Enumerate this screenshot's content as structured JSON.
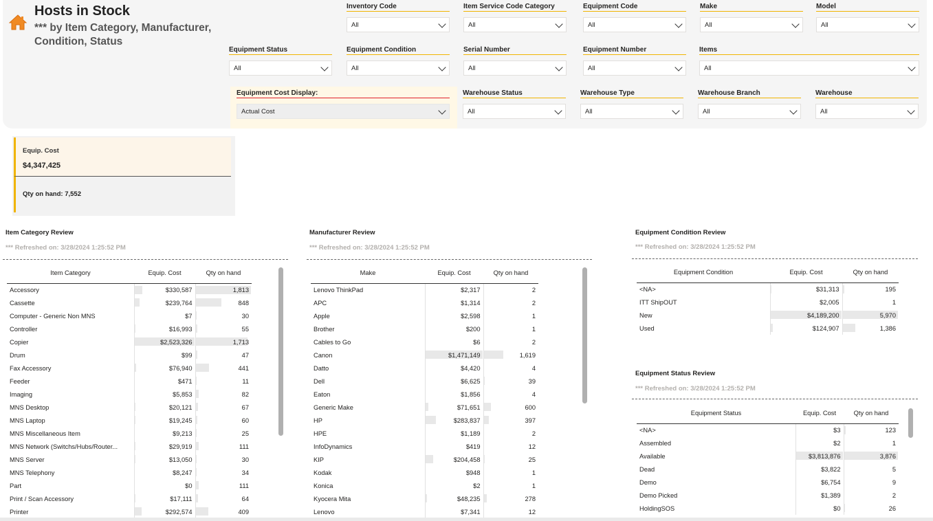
{
  "header": {
    "title": "Hosts in Stock",
    "subtitle": "*** by Item Category, Manufacturer, Condition, Status"
  },
  "filters": {
    "inventory_code": {
      "label": "Inventory Code",
      "value": "All"
    },
    "item_service_code_category": {
      "label": "Item Service Code Category",
      "value": "All"
    },
    "equipment_code": {
      "label": "Equipment Code",
      "value": "All"
    },
    "make": {
      "label": "Make",
      "value": "All"
    },
    "model": {
      "label": "Model",
      "value": "All"
    },
    "equipment_status": {
      "label": "Equipment Status",
      "value": "All"
    },
    "equipment_condition": {
      "label": "Equipment Condition",
      "value": "All"
    },
    "serial_number": {
      "label": "Serial Number",
      "value": "All"
    },
    "equipment_number": {
      "label": "Equipment Number",
      "value": "All"
    },
    "items": {
      "label": "Items",
      "value": "All"
    },
    "equipment_cost_display": {
      "label": "Equipment Cost Display:",
      "value": "Actual Cost"
    },
    "warehouse_status": {
      "label": "Warehouse Status",
      "value": "All"
    },
    "warehouse_type": {
      "label": "Warehouse Type",
      "value": "All"
    },
    "warehouse_branch": {
      "label": "Warehouse Branch",
      "value": "All"
    },
    "warehouse": {
      "label": "Warehouse",
      "value": "All"
    }
  },
  "card": {
    "cost_label": "Equip. Cost",
    "cost_value": "$4,347,425",
    "qty_label": "Qty on hand:",
    "qty_value": "7,552"
  },
  "refreshed": "*** Refreshed on: 3/28/2024 1:25:52 PM",
  "item_category": {
    "title": "Item Category Review",
    "columns": [
      "Item Category",
      "Equip. Cost",
      "Qty on hand"
    ],
    "rows": [
      {
        "name": "Accessory",
        "cost": "$330,587",
        "qty": "1,813",
        "cost_f": 0.13,
        "qty_f": 1.0
      },
      {
        "name": "Cassette",
        "cost": "$239,764",
        "qty": "848",
        "cost_f": 0.09,
        "qty_f": 0.47
      },
      {
        "name": "Computer - Generic Non MNS",
        "cost": "$7",
        "qty": "30",
        "cost_f": 0,
        "qty_f": 0.02
      },
      {
        "name": "Controller",
        "cost": "$16,993",
        "qty": "55",
        "cost_f": 0.01,
        "qty_f": 0.03
      },
      {
        "name": "Copier",
        "cost": "$2,523,326",
        "qty": "1,713",
        "cost_f": 1.0,
        "qty_f": 0.94
      },
      {
        "name": "Drum",
        "cost": "$99",
        "qty": "47",
        "cost_f": 0,
        "qty_f": 0.03
      },
      {
        "name": "Fax Accessory",
        "cost": "$76,940",
        "qty": "441",
        "cost_f": 0.03,
        "qty_f": 0.24
      },
      {
        "name": "Feeder",
        "cost": "$471",
        "qty": "11",
        "cost_f": 0,
        "qty_f": 0.01
      },
      {
        "name": "Imaging",
        "cost": "$5,853",
        "qty": "82",
        "cost_f": 0,
        "qty_f": 0.05
      },
      {
        "name": "MNS Desktop",
        "cost": "$20,121",
        "qty": "67",
        "cost_f": 0.01,
        "qty_f": 0.04
      },
      {
        "name": "MNS Laptop",
        "cost": "$19,245",
        "qty": "60",
        "cost_f": 0.01,
        "qty_f": 0.03
      },
      {
        "name": "MNS Miscellaneous Item",
        "cost": "$9,213",
        "qty": "25",
        "cost_f": 0,
        "qty_f": 0.01
      },
      {
        "name": "MNS Network (Switchs/Hubs/Router...",
        "cost": "$29,919",
        "qty": "111",
        "cost_f": 0.01,
        "qty_f": 0.06
      },
      {
        "name": "MNS Server",
        "cost": "$13,050",
        "qty": "30",
        "cost_f": 0.01,
        "qty_f": 0.02
      },
      {
        "name": "MNS Telephony",
        "cost": "$8,247",
        "qty": "34",
        "cost_f": 0,
        "qty_f": 0.02
      },
      {
        "name": "Part",
        "cost": "$0",
        "qty": "111",
        "cost_f": 0,
        "qty_f": 0.06
      },
      {
        "name": "Print / Scan Accessory",
        "cost": "$17,111",
        "qty": "64",
        "cost_f": 0.01,
        "qty_f": 0.04
      },
      {
        "name": "Printer",
        "cost": "$292,574",
        "qty": "409",
        "cost_f": 0.12,
        "qty_f": 0.23
      }
    ]
  },
  "manufacturer": {
    "title": "Manufacturer Review",
    "columns": [
      "Make",
      "Equip. Cost",
      "Qty on hand"
    ],
    "rows": [
      {
        "name": "Lenovo ThinkPad",
        "cost": "$2,317",
        "qty": "2",
        "cost_f": 0,
        "qty_f": 0
      },
      {
        "name": "APC",
        "cost": "$1,314",
        "qty": "2",
        "cost_f": 0,
        "qty_f": 0
      },
      {
        "name": "Apple",
        "cost": "$2,598",
        "qty": "1",
        "cost_f": 0,
        "qty_f": 0
      },
      {
        "name": "Brother",
        "cost": "$200",
        "qty": "1",
        "cost_f": 0,
        "qty_f": 0
      },
      {
        "name": "Cables to Go",
        "cost": "$6",
        "qty": "2",
        "cost_f": 0,
        "qty_f": 0
      },
      {
        "name": "Canon",
        "cost": "$1,471,149",
        "qty": "1,619",
        "cost_f": 1.0,
        "qty_f": 0.37
      },
      {
        "name": "Datto",
        "cost": "$4,420",
        "qty": "4",
        "cost_f": 0,
        "qty_f": 0
      },
      {
        "name": "Dell",
        "cost": "$6,625",
        "qty": "39",
        "cost_f": 0,
        "qty_f": 0.01
      },
      {
        "name": "Eaton",
        "cost": "$1,856",
        "qty": "4",
        "cost_f": 0,
        "qty_f": 0
      },
      {
        "name": "Generic Make",
        "cost": "$71,651",
        "qty": "600",
        "cost_f": 0.05,
        "qty_f": 0.14
      },
      {
        "name": "HP",
        "cost": "$283,837",
        "qty": "397",
        "cost_f": 0.19,
        "qty_f": 0.09
      },
      {
        "name": "HPE",
        "cost": "$1,189",
        "qty": "2",
        "cost_f": 0,
        "qty_f": 0
      },
      {
        "name": "InfoDynamics",
        "cost": "$419",
        "qty": "12",
        "cost_f": 0,
        "qty_f": 0
      },
      {
        "name": "KIP",
        "cost": "$204,458",
        "qty": "25",
        "cost_f": 0.14,
        "qty_f": 0.01
      },
      {
        "name": "Kodak",
        "cost": "$948",
        "qty": "1",
        "cost_f": 0,
        "qty_f": 0
      },
      {
        "name": "Konica",
        "cost": "$2",
        "qty": "1",
        "cost_f": 0,
        "qty_f": 0
      },
      {
        "name": "Kyocera Mita",
        "cost": "$48,235",
        "qty": "278",
        "cost_f": 0.03,
        "qty_f": 0.06
      },
      {
        "name": "Lenovo",
        "cost": "$7,341",
        "qty": "12",
        "cost_f": 0,
        "qty_f": 0
      }
    ]
  },
  "condition": {
    "title": "Equipment Condition Review",
    "columns": [
      "Equipment Condition",
      "Equip. Cost",
      "Qty on hand"
    ],
    "rows": [
      {
        "name": "<NA>",
        "cost": "$31,313",
        "qty": "195",
        "cost_f": 0.01,
        "qty_f": 0.03
      },
      {
        "name": "ITT ShipOUT",
        "cost": "$2,005",
        "qty": "1",
        "cost_f": 0,
        "qty_f": 0
      },
      {
        "name": "New",
        "cost": "$4,189,200",
        "qty": "5,970",
        "cost_f": 1.0,
        "qty_f": 1.0
      },
      {
        "name": "Used",
        "cost": "$124,907",
        "qty": "1,386",
        "cost_f": 0.03,
        "qty_f": 0.23
      }
    ]
  },
  "status": {
    "title": "Equipment Status Review",
    "columns": [
      "Equipment Status",
      "Equip. Cost",
      "Qty on hand"
    ],
    "rows": [
      {
        "name": "<NA>",
        "cost": "$3",
        "qty": "123",
        "cost_f": 0,
        "qty_f": 0.03
      },
      {
        "name": "Assembled",
        "cost": "$2",
        "qty": "1",
        "cost_f": 0,
        "qty_f": 0
      },
      {
        "name": "Available",
        "cost": "$3,813,876",
        "qty": "3,876",
        "cost_f": 1.0,
        "qty_f": 1.0
      },
      {
        "name": "Dead",
        "cost": "$3,822",
        "qty": "5",
        "cost_f": 0,
        "qty_f": 0
      },
      {
        "name": "Demo",
        "cost": "$6,754",
        "qty": "9",
        "cost_f": 0,
        "qty_f": 0
      },
      {
        "name": "Demo Picked",
        "cost": "$1,389",
        "qty": "2",
        "cost_f": 0,
        "qty_f": 0
      },
      {
        "name": "HoldingSOS",
        "cost": "$0",
        "qty": "26",
        "cost_f": 0,
        "qty_f": 0.01
      }
    ]
  }
}
